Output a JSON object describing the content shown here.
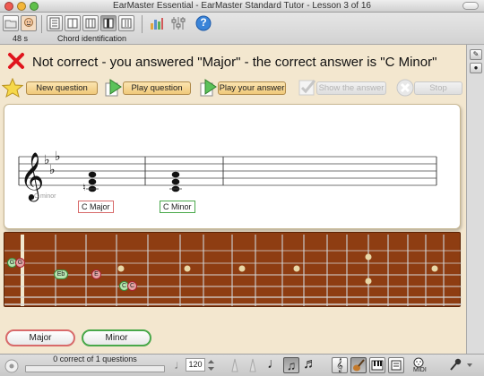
{
  "window": {
    "title": "EarMaster Essential - EarMaster Standard Tutor - Lesson 3 of 16"
  },
  "toolbar": {
    "timer": "48 s",
    "exercise_type": "Chord identification",
    "help_label": "?"
  },
  "feedback": {
    "message": "Not correct - you answered \"Major\" - the correct answer is \"C Minor\"",
    "status": "incorrect"
  },
  "controls": {
    "new_question": "New question",
    "play_question": "Play question",
    "play_your_answer": "Play your answer",
    "show_the_answer": "Show the answer",
    "stop": "Stop"
  },
  "score": {
    "clef": "treble",
    "key_signature": "3 flats",
    "caption": "C minor",
    "user_answer_label": "C Major",
    "correct_answer_label": "C Minor"
  },
  "fretboard": {
    "notes": [
      {
        "label": "G",
        "string": 2,
        "fret": 0,
        "kind": "user"
      },
      {
        "label": "G",
        "string": 2,
        "fret": 0,
        "kind": "correct"
      },
      {
        "label": "Eb",
        "string": 3,
        "fret": 1,
        "kind": "correct"
      },
      {
        "label": "E",
        "string": 3,
        "fret": 2,
        "kind": "user"
      },
      {
        "label": "C",
        "string": 5,
        "fret": 3,
        "kind": "correct"
      },
      {
        "label": "C",
        "string": 5,
        "fret": 3,
        "kind": "user"
      }
    ],
    "inlays": [
      "3",
      "5",
      "7",
      "9",
      "12",
      "15",
      "17"
    ]
  },
  "answers": {
    "major": "Major",
    "minor": "Minor"
  },
  "status": {
    "progress_text": "0 correct of 1 questions",
    "progress": 0,
    "tempo": "120"
  },
  "colors": {
    "content_bg": "#f3e7cf",
    "wrong": "#e0151d",
    "correct_green": "#49a84a",
    "wrong_red": "#d86a6a",
    "fretboard": "#8e3d12"
  }
}
